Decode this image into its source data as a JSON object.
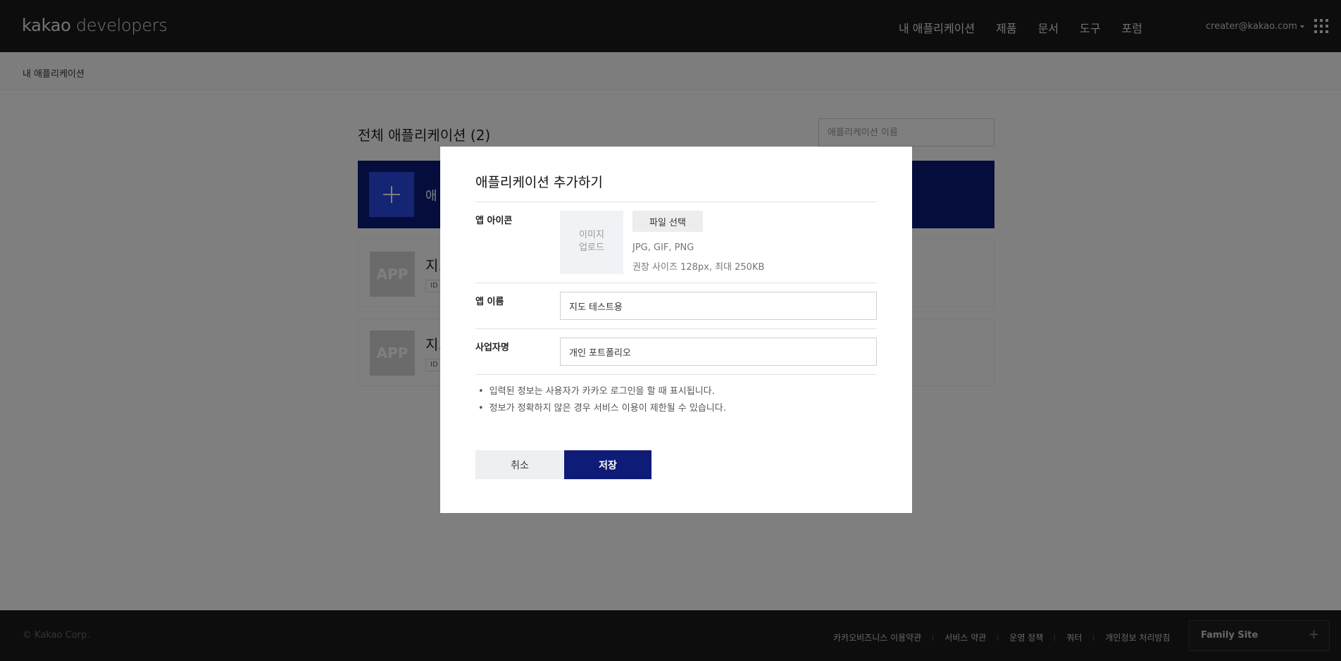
{
  "header": {
    "logo_brand": "kakao",
    "logo_suffix": " developers",
    "nav": [
      "내 애플리케이션",
      "제품",
      "문서",
      "도구",
      "포럼"
    ],
    "account": "creater@kakao.com",
    "menu_icon": "grid-icon"
  },
  "breadcrumb": "내 애플리케이션",
  "main": {
    "title": "전체 애플리케이션 (2)",
    "search_placeholder": "애플리케이션 이름",
    "add_card_label": "애",
    "apps": [
      {
        "thumb": "APP",
        "name": "지.",
        "id_badge": "ID"
      },
      {
        "thumb": "APP",
        "name": "지.",
        "id_badge": "ID"
      }
    ]
  },
  "modal": {
    "title": "애플리케이션 추가하기",
    "icon_label": "앱 아이콘",
    "icon_upload_line1": "이미지",
    "icon_upload_line2": "업로드",
    "file_button": "파일 선택",
    "file_hint_formats": "JPG, GIF, PNG",
    "file_hint_size": "권장 사이즈 128px, 최대 250KB",
    "app_name_label": "앱 이름",
    "app_name_value": "지도 테스트용",
    "business_label": "사업자명",
    "business_value": "개인 포트폴리오",
    "notes": [
      "입력된 정보는 사용자가 카카오 로그인을 할 때 표시됩니다.",
      "정보가 정확하지 않은 경우 서비스 이용이 제한될 수 있습니다."
    ],
    "cancel": "취소",
    "save": "저장"
  },
  "footer": {
    "copyright": "© Kakao Corp.",
    "links": [
      "카카오비즈니스 이용약관",
      "서비스 약관",
      "운영 정책",
      "쿼터",
      "개인정보 처리방침"
    ],
    "family_site": "Family Site",
    "family_plus": "+"
  },
  "colors": {
    "header_bg": "#1a1a1a",
    "accent_navy": "#0e1c78",
    "accent_blue": "#2b48e6"
  }
}
